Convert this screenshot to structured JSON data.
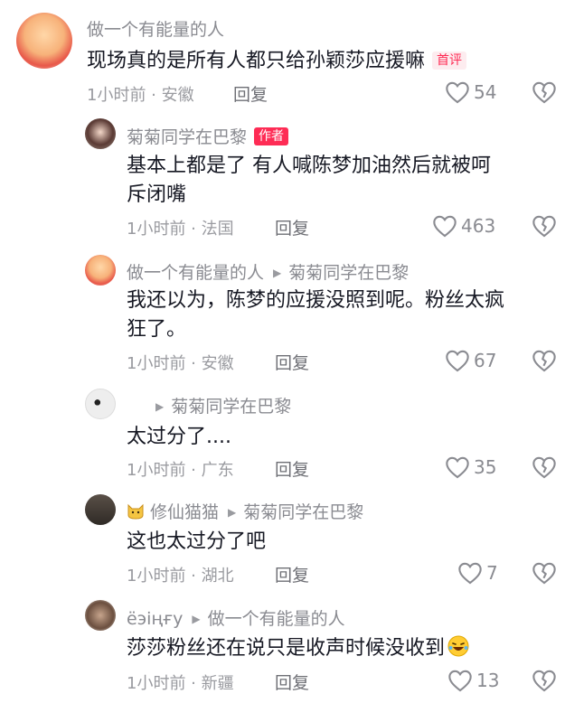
{
  "comments": [
    {
      "username": "做一个有能量的人",
      "text": "现场真的是所有人都只给孙颖莎应援嘛",
      "badge": "首评",
      "meta": "1小时前 · 安徽",
      "reply_label": "回复",
      "likes": "54"
    },
    {
      "username": "菊菊同学在巴黎",
      "badge": "作者",
      "text_line1": "基本上都是了 有人喊陈梦加油然后就被呵",
      "text_line2": "斥闭嘴",
      "meta": "1小时前 · 法国",
      "reply_label": "回复",
      "likes": "463"
    },
    {
      "username": "做一个有能量的人",
      "reply_to": "菊菊同学在巴黎",
      "text_line1": "我还以为，陈梦的应援没照到呢。粉丝太疯",
      "text_line2": "狂了。",
      "meta": "1小时前 · 安徽",
      "reply_label": "回复",
      "likes": "67"
    },
    {
      "username": "",
      "reply_to": "菊菊同学在巴黎",
      "text": "太过分了....",
      "meta": "1小时前 · 广东",
      "reply_label": "回复",
      "likes": "35"
    },
    {
      "username": "修仙猫猫",
      "reply_to": "菊菊同学在巴黎",
      "text": "这也太过分了吧",
      "meta": "1小时前 · 湖北",
      "reply_label": "回复",
      "likes": "7"
    },
    {
      "username": "ёэіңғу",
      "reply_to": "做一个有能量的人",
      "text": "莎莎粉丝还在说只是收声时候没收到",
      "meta": "1小时前 · 新疆",
      "reply_label": "回复",
      "likes": "13"
    }
  ],
  "colors": {
    "accent": "#fe2c55",
    "meta": "#9a9ba0",
    "text": "#161823"
  },
  "icons": [
    "heart-outline-icon",
    "broken-heart-icon",
    "play-arrow-icon",
    "cat-emoji-icon",
    "laughing-emoji-icon"
  ]
}
